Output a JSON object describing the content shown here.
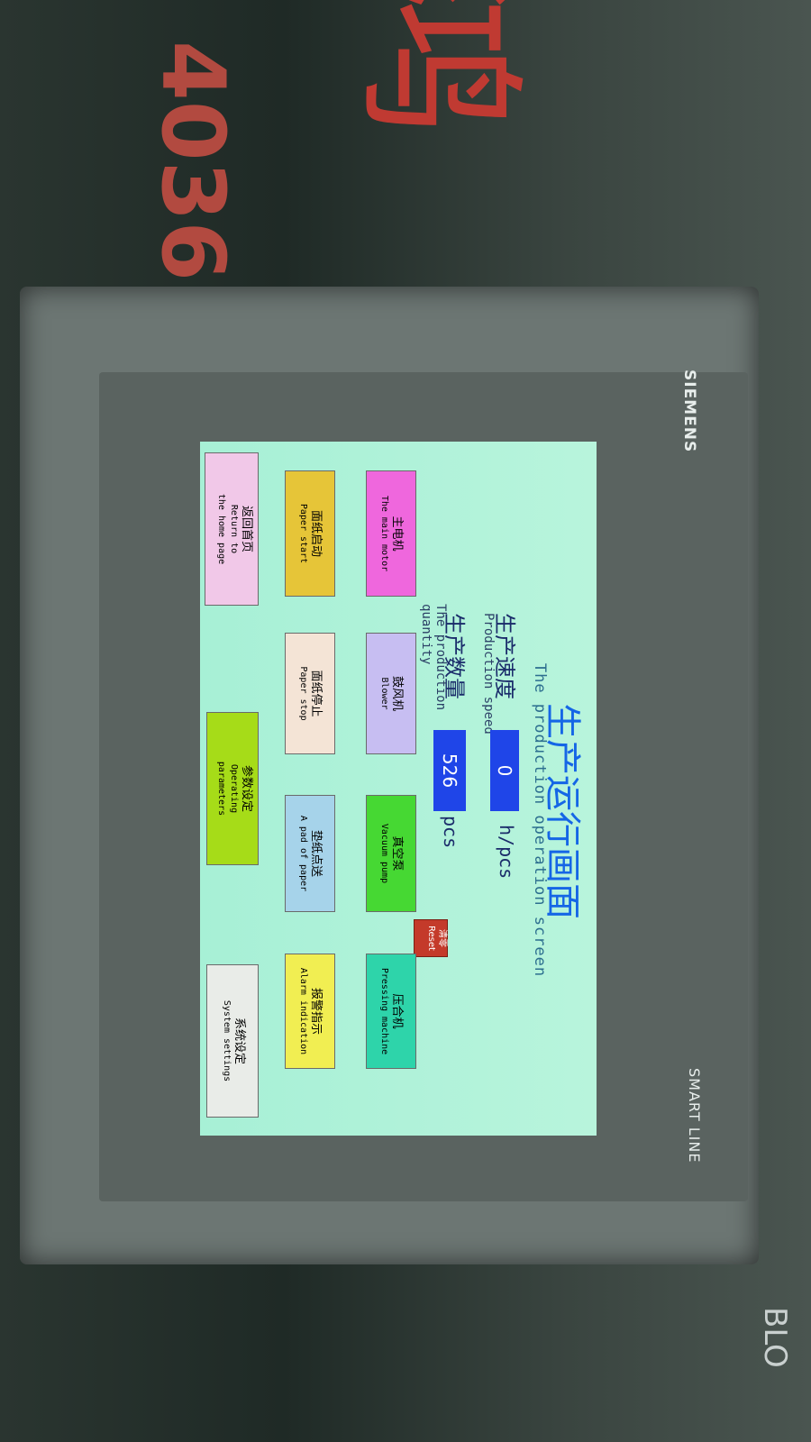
{
  "wall": {
    "number": "4036",
    "brush": "鸿",
    "bottom": "BLO"
  },
  "brand": {
    "top": "SIEMENS",
    "bottom": "SMART LINE"
  },
  "screen": {
    "title_cn": "生产运行画面",
    "title_en": "The production operation screen",
    "speed": {
      "label_cn": "生产速度",
      "label_en": "Production speed",
      "value": "0",
      "unit": "h/pcs"
    },
    "quantity": {
      "label_cn": "生产数量",
      "label_en_1": "The production",
      "label_en_2": "quantity",
      "value": "526",
      "unit": "pcs"
    },
    "reset": {
      "cn": "清零",
      "en": "Reset"
    },
    "buttons": [
      {
        "cn": "主电机",
        "en": "The main motor",
        "color": "#ef67dd"
      },
      {
        "cn": "鼓风机",
        "en": "Blower",
        "color": "#c7bef2"
      },
      {
        "cn": "真空泵",
        "en": "Vacuum pump",
        "color": "#46d833"
      },
      {
        "cn": "压合机",
        "en": "Pressing machine",
        "color": "#2ed4aa"
      },
      {
        "cn": "面纸启动",
        "en": "Paper start",
        "color": "#e6c538"
      },
      {
        "cn": "面纸停止",
        "en": "Paper stop",
        "color": "#f4e4d6"
      },
      {
        "cn": "垫纸点送",
        "en": "A pad of paper",
        "color": "#a6d3ea"
      },
      {
        "cn": "报警指示",
        "en": "Alarm indication",
        "color": "#f1ee52"
      },
      {
        "cn": "返回首页",
        "en_1": "Return to",
        "en_2": "the home page",
        "color": "#f1c8e8"
      },
      {
        "cn": "参数设定",
        "en_1": "Operating",
        "en_2": "parameters",
        "color": "#a6dc18"
      },
      {
        "cn": "系统设定",
        "en": "System settings",
        "color": "#e9ece8"
      }
    ]
  }
}
